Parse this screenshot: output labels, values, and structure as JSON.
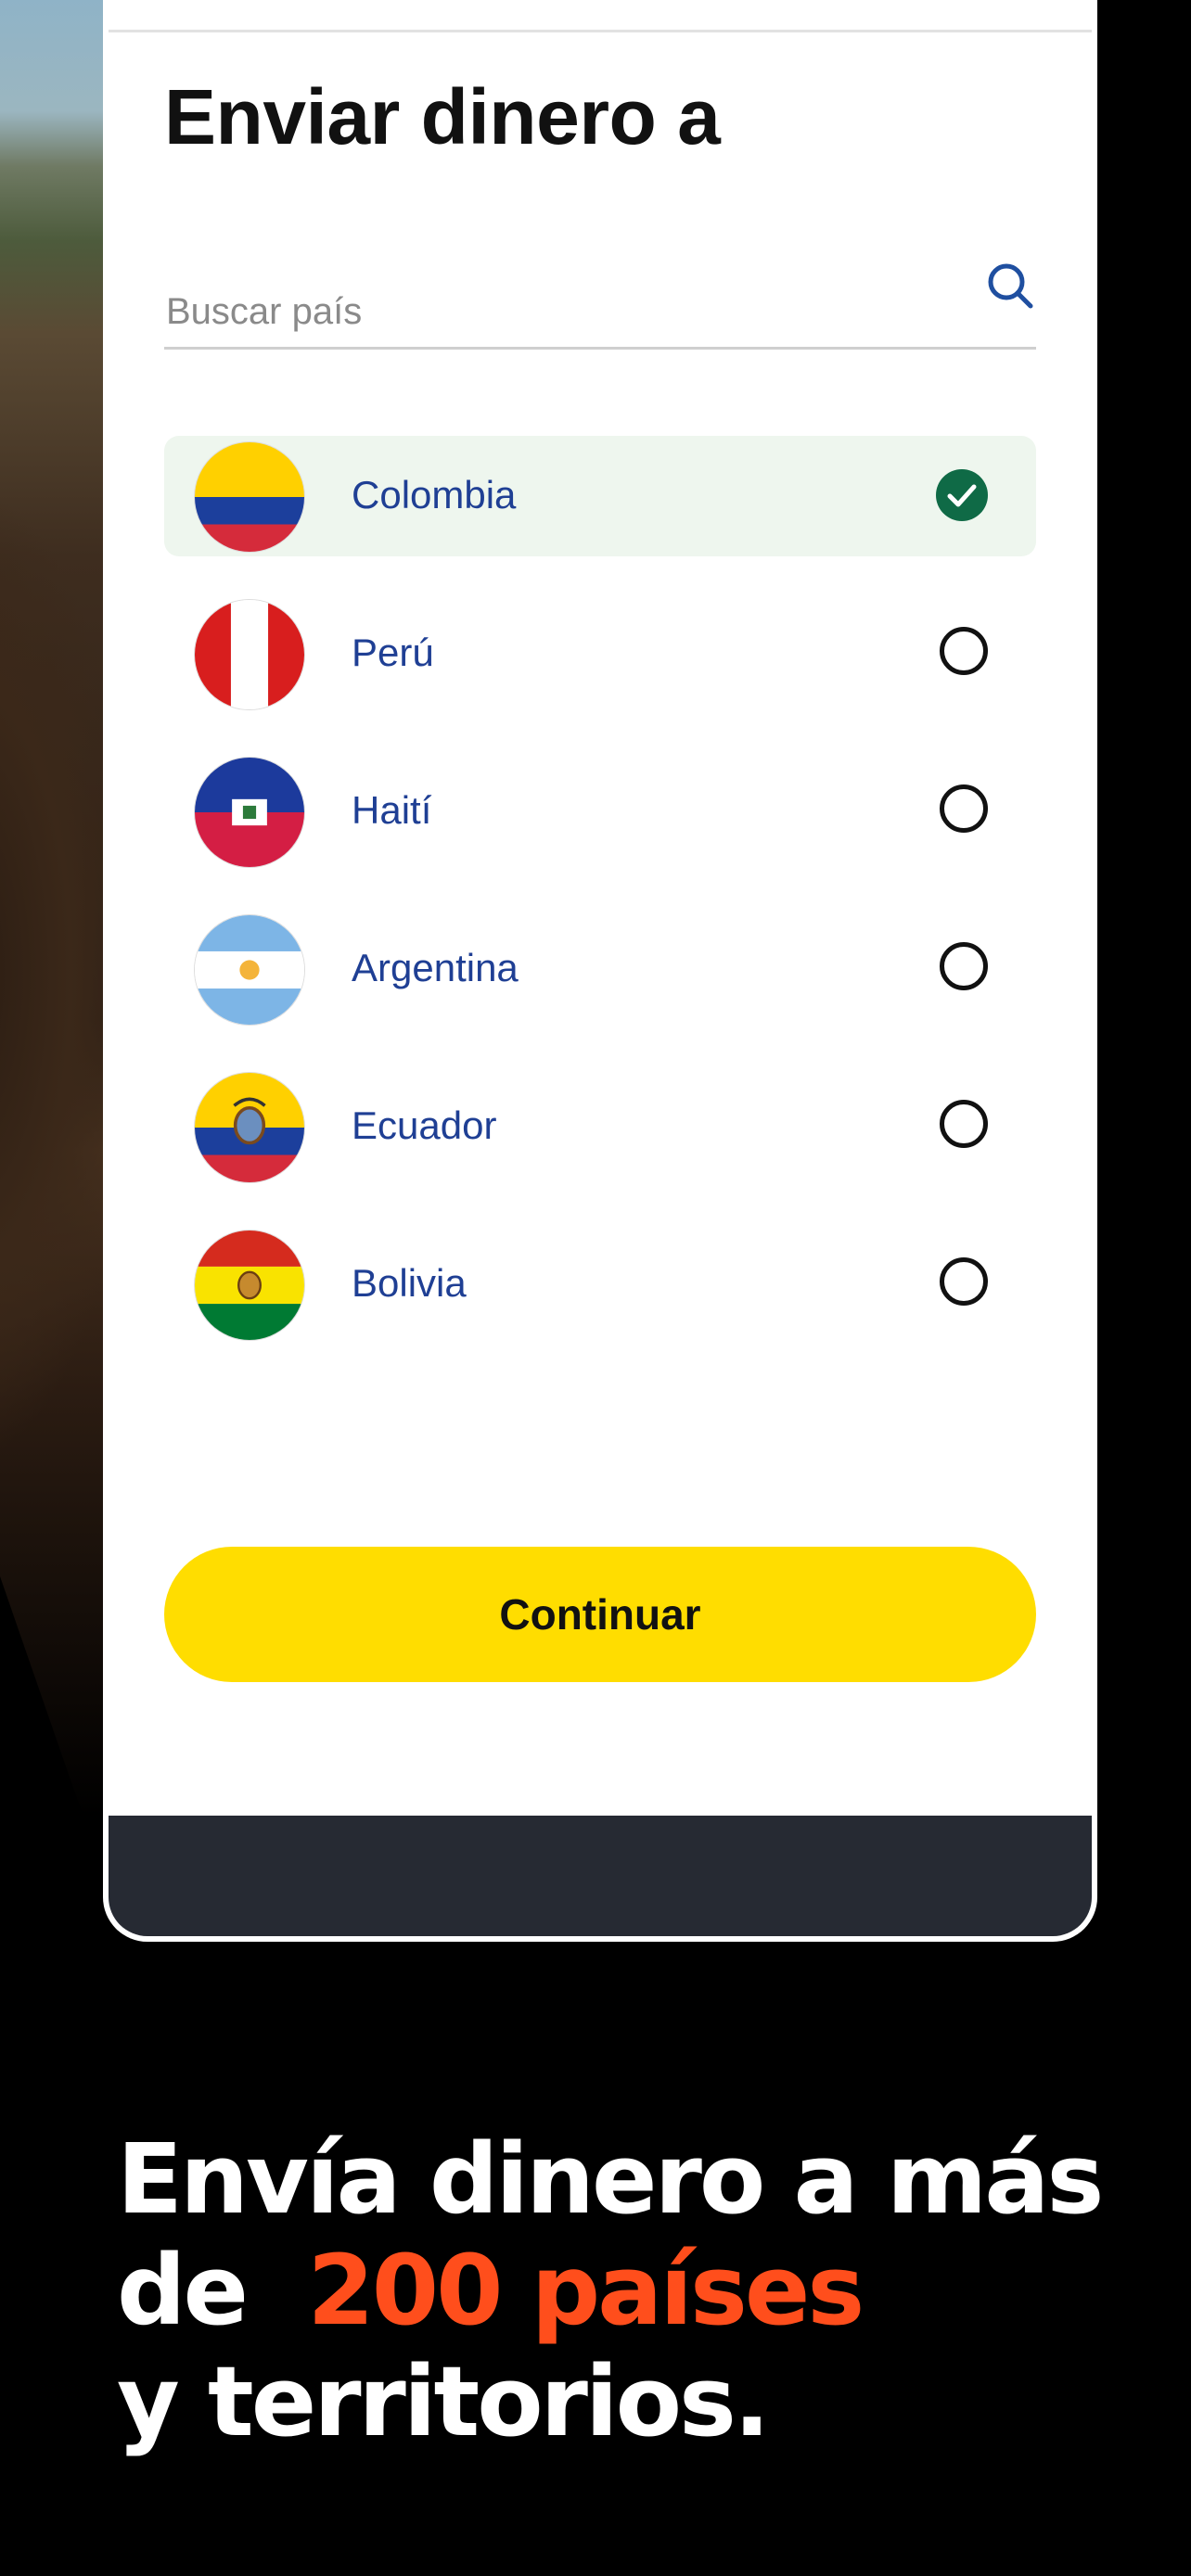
{
  "screen": {
    "title": "Enviar dinero a",
    "search": {
      "placeholder": "Buscar país",
      "value": ""
    },
    "countries": [
      {
        "name": "Colombia",
        "selected": true
      },
      {
        "name": "Perú",
        "selected": false
      },
      {
        "name": "Haití",
        "selected": false
      },
      {
        "name": "Argentina",
        "selected": false
      },
      {
        "name": "Ecuador",
        "selected": false
      },
      {
        "name": "Bolivia",
        "selected": false
      }
    ],
    "continue_label": "Continuar"
  },
  "promo": {
    "line1": "Envía dinero a más",
    "line2_prefix": "de",
    "line2_highlight": "200 países",
    "line3": "y territorios."
  },
  "colors": {
    "accent_yellow": "#ffdd00",
    "selected_bg": "#eef6ee",
    "check_green": "#0f6a46",
    "country_text": "#1f3f94",
    "promo_highlight": "#ff4e1c"
  },
  "icons": {
    "search": "search-icon",
    "check": "check-circle-icon",
    "radio": "radio-empty-icon"
  }
}
